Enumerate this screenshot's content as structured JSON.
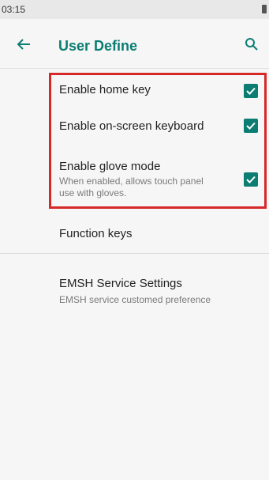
{
  "status_bar": {
    "time": "03:15"
  },
  "toolbar": {
    "title": "User Define"
  },
  "preferences": [
    {
      "title": "Enable home key",
      "checked": true
    },
    {
      "title": "Enable on-screen keyboard",
      "checked": true
    },
    {
      "title": "Enable glove mode",
      "summary": "When enabled, allows touch panel use with gloves.",
      "checked": true
    }
  ],
  "function_keys": {
    "title": "Function keys"
  },
  "emsh": {
    "title": "EMSH Service Settings",
    "summary": "EMSH service customed preference"
  },
  "colors": {
    "accent": "#0b7d72",
    "highlight": "#d62828"
  }
}
